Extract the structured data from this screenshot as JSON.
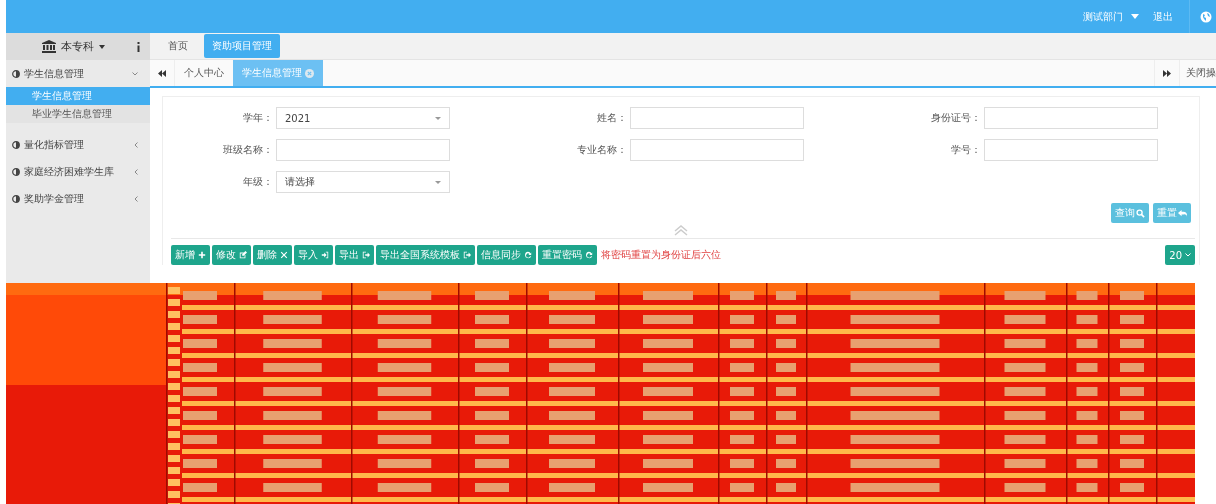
{
  "header": {
    "department": "测试部门",
    "logout": "退出"
  },
  "sidebar": {
    "title": "本专科",
    "menus": [
      {
        "label": "学生信息管理",
        "expanded": true,
        "children": [
          {
            "label": "学生信息管理",
            "selected": true
          },
          {
            "label": "毕业学生信息管理",
            "selected": false
          }
        ]
      },
      {
        "label": "量化指标管理",
        "expanded": false
      },
      {
        "label": "家庭经济困难学生库",
        "expanded": false
      },
      {
        "label": "奖助学金管理",
        "expanded": false
      }
    ]
  },
  "top_tabs": [
    {
      "label": "首页",
      "selected": false
    },
    {
      "label": "资助项目管理",
      "selected": true
    }
  ],
  "page_tabs": [
    {
      "label": "个人中心",
      "selected": false,
      "closable": false
    },
    {
      "label": "学生信息管理",
      "selected": true,
      "closable": true
    }
  ],
  "close_ops": "关闭操",
  "form": {
    "fields": [
      {
        "label": "学年：",
        "kind": "select",
        "value": "2021"
      },
      {
        "label": "姓名：",
        "kind": "text"
      },
      {
        "label": "身份证号：",
        "kind": "text"
      },
      {
        "label": "班级名称：",
        "kind": "text"
      },
      {
        "label": "专业名称：",
        "kind": "text"
      },
      {
        "label": "学号：",
        "kind": "text"
      },
      {
        "label": "年级：",
        "kind": "select",
        "value": "请选择"
      }
    ],
    "buttons": [
      {
        "label": "查询",
        "kind": "search"
      },
      {
        "label": "重置",
        "kind": "undo"
      }
    ]
  },
  "toolbar": {
    "buttons": [
      {
        "label": "新增",
        "kind": "add"
      },
      {
        "label": "修改",
        "kind": "edit"
      },
      {
        "label": "删除",
        "kind": "delete"
      },
      {
        "label": "导入",
        "kind": "import"
      },
      {
        "label": "导出",
        "kind": "export"
      },
      {
        "label": "导出全国系统模板",
        "kind": "export"
      },
      {
        "label": "信息同步",
        "kind": "sync"
      },
      {
        "label": "重置密码",
        "kind": "sync"
      }
    ],
    "note": "将密码重置为身份证后六位",
    "page_size": "20"
  }
}
